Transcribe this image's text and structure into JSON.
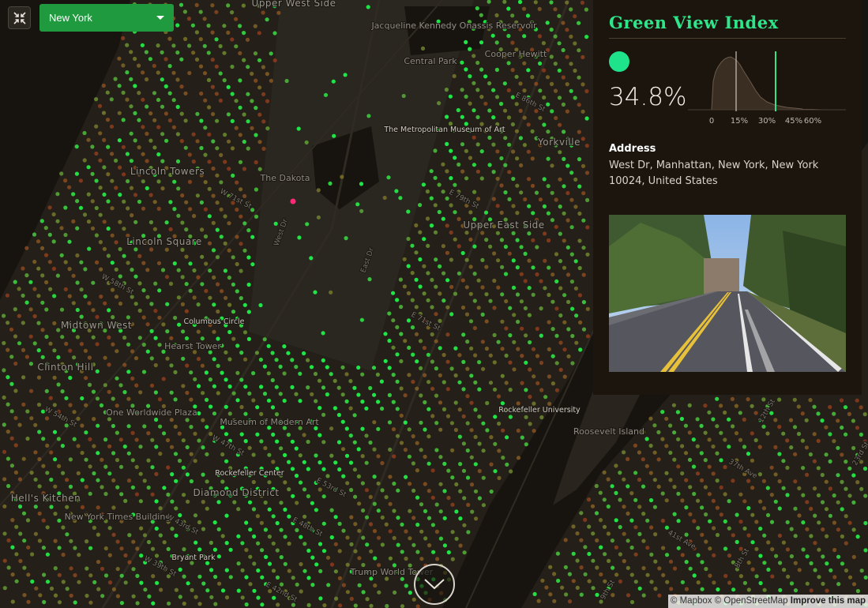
{
  "city_select": {
    "selected": "New York"
  },
  "panel": {
    "title": "Green View Index",
    "value": "34.8%",
    "histogram_ticks": [
      "0",
      "15%",
      "30%",
      "45%",
      "60%"
    ],
    "address_label": "Address",
    "address": "West Dr, Manhattan, New York, New York 10024, United States"
  },
  "attribution": {
    "mapbox": "© Mapbox",
    "osm": "© OpenStreetMap",
    "improve": "Improve this map"
  },
  "icons": {
    "fullscreen": "exit-fullscreen-icon",
    "scroll_down": "chevron-down-icon",
    "selected_point": "selected-location-marker"
  },
  "colors": {
    "accent": "#2ee58a",
    "select_bg": "#1f9a3e",
    "panel_bg": "#1b150e",
    "selected_marker": "#ff2a78"
  },
  "map_labels": {
    "upper_west_side": "Upper West Side",
    "jacqueline": "Jacqueline Kennedy Onassis Reservoir",
    "central_park": "Central Park",
    "cooper_hewitt": "Cooper Hewitt",
    "met": "The Metropolitan Museum of Art",
    "yorkville": "Yorkville",
    "lincoln_towers": "Lincoln Towers",
    "the_dakota": "The Dakota",
    "upper_east_side": "Upper East Side",
    "lincoln_square": "Lincoln Square",
    "midtown_west": "Midtown West",
    "columbus_circle": "Columbus Circle",
    "hearst_tower": "Hearst Tower",
    "clinton_hill": "Clinton Hill",
    "one_worldwide_plaza": "One Worldwide Plaza",
    "moma": "Museum of Modern Art",
    "rockefeller_university": "Rockefeller University",
    "roosevelt_island": "Roosevelt Island",
    "rockefeller_center": "Rockefeller Center",
    "hells_kitchen": "Hell's Kitchen",
    "diamond_district": "Diamond District",
    "nyt_building": "New York Times Building",
    "bryant_park": "Bryant Park",
    "trump_world_tower": "Trump World Tower",
    "w_58th": "W 58th St",
    "w_43rd": "W 43rd St",
    "w_39th": "W 39th St",
    "e_42nd": "E 42nd St",
    "w_71st": "W 71st St",
    "west_dr": "West Dr",
    "east_dr": "East Dr",
    "madison_ave": "Madison Ave",
    "e_79th": "E 79th St",
    "e_71st": "E 71st St",
    "e_64th": "E 64th St",
    "e_86th": "E 86th St",
    "w_54th": "W 54th St",
    "w_47th": "W 47th St",
    "lexington": "Lexington Ave",
    "e_53rd": "E 53rd St",
    "e_48th": "E 48th St",
    "ninth_st": "9th St",
    "twelfth_st": "12th St",
    "thirty_seventh_ave": "37th Ave",
    "forty_first_ave": "41st Ave",
    "twenty_third_st": "23rd St",
    "eighth_st": "8th St"
  }
}
